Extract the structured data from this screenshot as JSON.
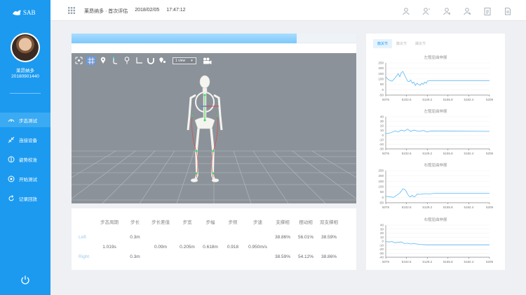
{
  "app": {
    "logo_text": "SAB"
  },
  "user": {
    "name": "莱昂纳多",
    "id": "20180901440"
  },
  "sidebar": {
    "items": [
      {
        "label": "步态测试",
        "icon": "gait-icon",
        "active": true
      },
      {
        "label": "连接设备",
        "icon": "connect-icon",
        "active": false
      },
      {
        "label": "姿势校准",
        "icon": "calibrate-icon",
        "active": false
      },
      {
        "label": "开始测试",
        "icon": "play-icon",
        "active": false
      },
      {
        "label": "记录回放",
        "icon": "replay-icon",
        "active": false
      }
    ],
    "power_icon": "power-icon"
  },
  "header": {
    "breadcrumb": "莱昂纳多 · 首次评估",
    "date": "2018/02/05",
    "time": "17:47:12",
    "icons": [
      "user-icon",
      "users-icon",
      "group-icon",
      "team-icon",
      "report-icon",
      "document-icon"
    ]
  },
  "progress": {
    "fraction": 0.79
  },
  "viewer": {
    "view_select": "1 view",
    "tools": [
      "locate-icon",
      "grid-icon",
      "pin-icon",
      "rotate-icon",
      "marker-icon",
      "axes-icon",
      "magnet-icon",
      "multi-pin-icon"
    ],
    "camera_icon": "camera-icon"
  },
  "stats": {
    "headers": [
      "步态周期",
      "步长",
      "步长差值",
      "步宽",
      "步幅",
      "步频",
      "步速",
      "支撑相",
      "摆动相",
      "双支撑相"
    ],
    "left_label": "Left",
    "right_label": "Right",
    "gait_cycle": "1.019s",
    "step_length_left": "0.3m",
    "step_length_right": "0.3m",
    "step_diff": "0.09m",
    "step_width": "0.205m",
    "stride": "0.618m",
    "cadence": "0.918",
    "speed": "0.950m/s",
    "stance_left": "38.86%",
    "swing_left": "56.01%",
    "double_left": "38.59%",
    "stance_right": "38.59%",
    "swing_right": "54.12%",
    "double_right": "38.86%"
  },
  "right_panel": {
    "tabs": [
      "髋关节",
      "膝关节",
      "踝关节"
    ],
    "active_tab": 0
  },
  "chart_data": [
    {
      "type": "line",
      "title": "左髋屈曲伸展",
      "x_ticks": [
        "5076",
        "5102.6",
        "5129.2",
        "5155.8",
        "5182.4",
        "5209"
      ],
      "y_ticks": [
        250,
        200,
        150,
        100,
        50,
        0,
        -50
      ],
      "ylim": [
        -50,
        250
      ],
      "x": [
        5076,
        5080,
        5084,
        5088,
        5090,
        5092,
        5094,
        5096,
        5098,
        5100,
        5102,
        5104,
        5106,
        5108,
        5110,
        5112,
        5114,
        5116,
        5118,
        5120,
        5122,
        5124,
        5126,
        5128,
        5129.2,
        5132,
        5209
      ],
      "values": [
        120,
        90,
        80,
        110,
        130,
        150,
        120,
        160,
        170,
        140,
        110,
        80,
        75,
        90,
        60,
        70,
        40,
        60,
        50,
        40,
        60,
        50,
        70,
        60,
        80,
        85,
        85
      ]
    },
    {
      "type": "line",
      "title": "左髋屈曲伸展",
      "x_ticks": [
        "5076",
        "5102.6",
        "5129.2",
        "5155.8",
        "5182.4",
        "5209"
      ],
      "y_ticks": [
        40,
        30,
        20,
        10,
        0,
        -10,
        -20,
        -30
      ],
      "ylim": [
        -30,
        40
      ],
      "x": [
        5076,
        5082,
        5088,
        5092,
        5096,
        5100,
        5104,
        5108,
        5112,
        5118,
        5124,
        5129.2,
        5134,
        5209
      ],
      "values": [
        3,
        5,
        9,
        7,
        11,
        9,
        13,
        8,
        11,
        8,
        10,
        7,
        9,
        8
      ]
    },
    {
      "type": "line",
      "title": "右髋屈曲伸展",
      "x_ticks": [
        "5076",
        "5102.6",
        "5129.2",
        "5155.8",
        "5182.4",
        "5209"
      ],
      "y_ticks": [
        250,
        200,
        150,
        100,
        50,
        0,
        -50
      ],
      "ylim": [
        -50,
        250
      ],
      "x": [
        5076,
        5082,
        5086,
        5090,
        5094,
        5098,
        5100,
        5102,
        5104,
        5106,
        5108,
        5110,
        5112,
        5114,
        5116,
        5120,
        5126,
        5132,
        5140,
        5209
      ],
      "values": [
        10,
        5,
        0,
        20,
        40,
        80,
        75,
        60,
        30,
        10,
        5,
        20,
        5,
        10,
        30,
        28,
        35,
        32,
        38,
        38
      ]
    },
    {
      "type": "line",
      "title": "右髋屈曲伸展",
      "x_ticks": [
        "5076",
        "5102.6",
        "5129.2",
        "5155.8",
        "5182.4",
        "5209"
      ],
      "y_ticks": [
        40,
        30,
        20,
        10,
        0,
        -10,
        -20,
        -30,
        -40
      ],
      "ylim": [
        -40,
        40
      ],
      "x": [
        5076,
        5080,
        5084,
        5088,
        5092,
        5096,
        5100,
        5104,
        5108,
        5112,
        5120,
        5129.2,
        5209
      ],
      "values": [
        -1,
        -2,
        -1,
        -4,
        -3,
        -2,
        -6,
        -5,
        -7,
        -6,
        -8,
        -9,
        -9
      ]
    }
  ]
}
